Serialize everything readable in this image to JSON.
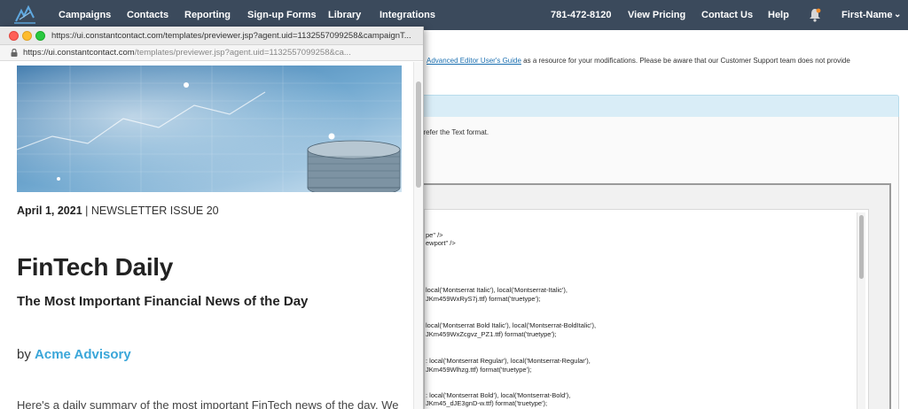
{
  "nav": {
    "items": [
      "Campaigns",
      "Contacts",
      "Reporting",
      "Sign-up Forms",
      "Library",
      "Integrations"
    ],
    "phone": "781-472-8120",
    "pricing": "View Pricing",
    "contact": "Contact Us",
    "help": "Help",
    "user": "First-Name",
    "bg_color": "#3b4a5c"
  },
  "background": {
    "guide_prefix": "",
    "guide_link": "Advanced Editor User's Guide",
    "guide_suffix": " as a resource for your modifications. Please be aware that our Customer Support team does not provide",
    "text_format_note": "prefer the Text format.",
    "code_lines": [
      "pe\" />",
      "ewport\" />",
      "local('Montserrat Italic'), local('Montserrat-Italic'),",
      "JKm459WxRyS7j.ttf) format('truetype');",
      "local('Montserrat Bold Italic'), local('Montserrat-BoldItalic'),",
      "JKm459WxZcgvz_PZ1.ttf) format('truetype');",
      ": local('Montserrat Regular'), local('Montserrat-Regular'),",
      "JKm459Wlhzg.ttf) format('truetype');",
      ": local('Montserrat Bold'), local('Montserrat-Bold'),",
      "JKm45_dJE3gnD-w.ttf) format('truetype');"
    ]
  },
  "popup": {
    "title": "https://ui.constantcontact.com/templates/previewer.jsp?agent.uid=1132557099258&campaignT...",
    "url_main": "https://ui.constantcontact.com",
    "url_path": "/templates/previewer.jsp?agent.uid=1132557099258&ca...",
    "date": "April 1, 2021",
    "issue": " | NEWSLETTER ISSUE 20",
    "headline": "FinTech Daily",
    "subhead": "The Most Important Financial News of the Day",
    "by": "by ",
    "brand": "Acme Advisory",
    "intro": "Here's a daily summary of the most important FinTech news of the day. We",
    "brand_color": "#3aa6d9"
  }
}
